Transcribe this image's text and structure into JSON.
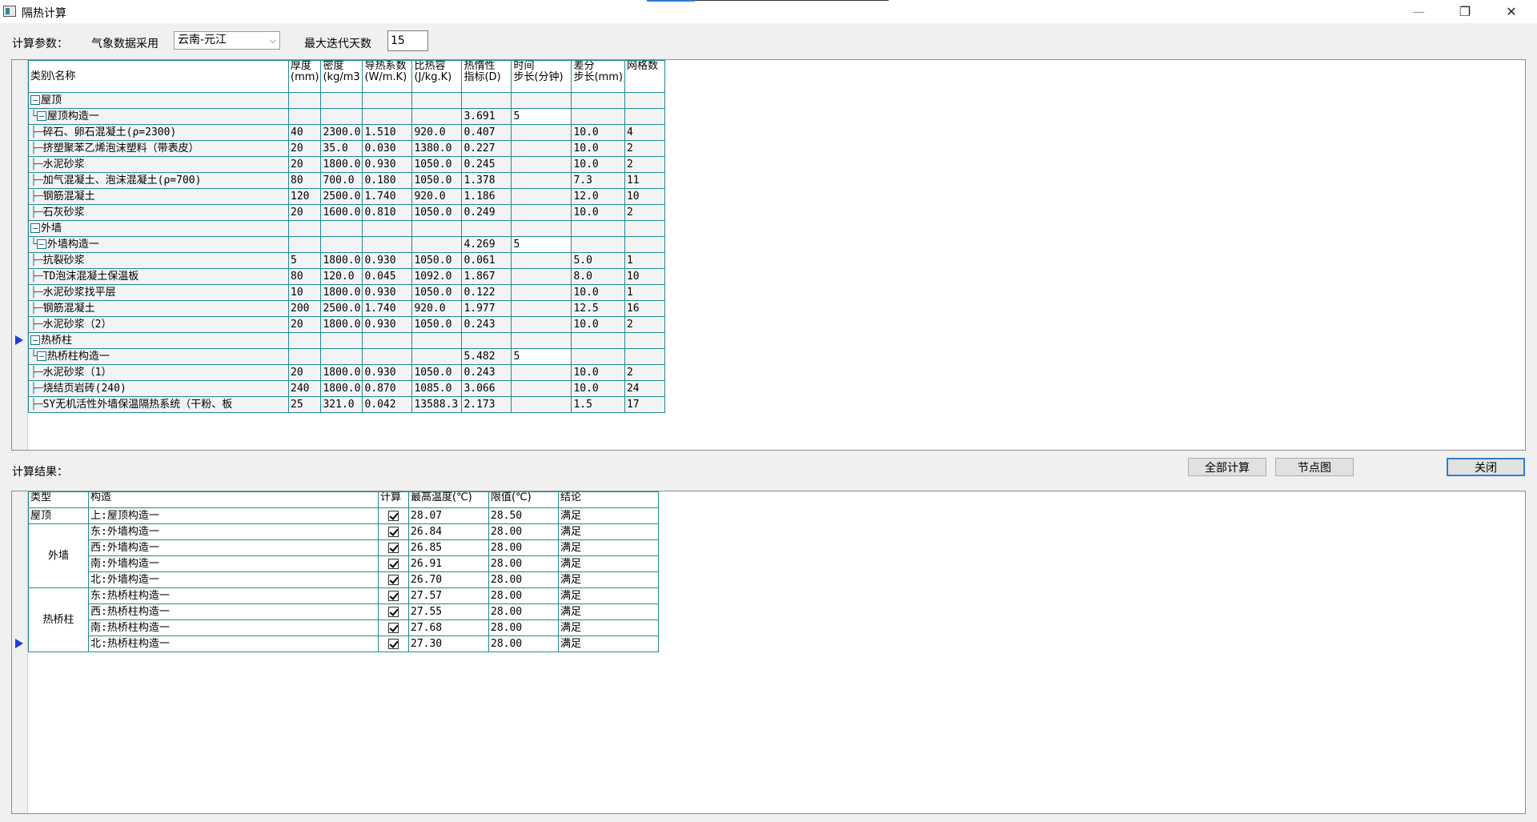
{
  "window": {
    "title": "隔热计算",
    "minimize": "—",
    "restore": "❐",
    "close": "✕"
  },
  "params": {
    "label": "计算参数：",
    "weather_label": "气象数据采用",
    "weather_value": "云南-元江",
    "max_days_label": "最大迭代天数",
    "max_days_value": "15"
  },
  "layers": {
    "headers": [
      "类别\\名称",
      "厚度\n(mm)",
      "密度\n(kg/m3",
      "导热系数\n(W/m.K)",
      "比热容\n(J/kg.K)",
      "热惰性\n指标(D)",
      "时间\n步长(分钟)",
      "差分\n步长(mm)",
      "网格数"
    ],
    "rows": [
      {
        "level": 0,
        "name": "屋顶",
        "cells": [
          "",
          "",
          "",
          "",
          "",
          "",
          "",
          ""
        ]
      },
      {
        "level": 1,
        "name": "屋顶构造一",
        "cells": [
          "",
          "",
          "",
          "",
          "3.691",
          "5",
          "",
          ""
        ]
      },
      {
        "level": 2,
        "name": "碎石、卵石混凝土(ρ=2300)",
        "cells": [
          "40",
          "2300.0",
          "1.510",
          "920.0",
          "0.407",
          "",
          "10.0",
          "4"
        ]
      },
      {
        "level": 2,
        "name": "挤塑聚苯乙烯泡沫塑料（带表皮）",
        "cells": [
          "20",
          "35.0",
          "0.030",
          "1380.0",
          "0.227",
          "",
          "10.0",
          "2"
        ]
      },
      {
        "level": 2,
        "name": "水泥砂浆",
        "cells": [
          "20",
          "1800.0",
          "0.930",
          "1050.0",
          "0.245",
          "",
          "10.0",
          "2"
        ]
      },
      {
        "level": 2,
        "name": "加气混凝土、泡沫混凝土(ρ=700)",
        "cells": [
          "80",
          "700.0",
          "0.180",
          "1050.0",
          "1.378",
          "",
          "7.3",
          "11"
        ]
      },
      {
        "level": 2,
        "name": "钢筋混凝土",
        "cells": [
          "120",
          "2500.0",
          "1.740",
          "920.0",
          "1.186",
          "",
          "12.0",
          "10"
        ]
      },
      {
        "level": 2,
        "name": "石灰砂浆",
        "cells": [
          "20",
          "1600.0",
          "0.810",
          "1050.0",
          "0.249",
          "",
          "10.0",
          "2"
        ]
      },
      {
        "level": 0,
        "name": "外墙",
        "cells": [
          "",
          "",
          "",
          "",
          "",
          "",
          "",
          ""
        ]
      },
      {
        "level": 1,
        "name": "外墙构造一",
        "cells": [
          "",
          "",
          "",
          "",
          "4.269",
          "5",
          "",
          ""
        ]
      },
      {
        "level": 2,
        "name": "抗裂砂浆",
        "cells": [
          "5",
          "1800.0",
          "0.930",
          "1050.0",
          "0.061",
          "",
          "5.0",
          "1"
        ]
      },
      {
        "level": 2,
        "name": "TD泡沫混凝土保温板",
        "cells": [
          "80",
          "120.0",
          "0.045",
          "1092.0",
          "1.867",
          "",
          "8.0",
          "10"
        ]
      },
      {
        "level": 2,
        "name": "水泥砂浆找平层",
        "cells": [
          "10",
          "1800.0",
          "0.930",
          "1050.0",
          "0.122",
          "",
          "10.0",
          "1"
        ]
      },
      {
        "level": 2,
        "name": "钢筋混凝土",
        "cells": [
          "200",
          "2500.0",
          "1.740",
          "920.0",
          "1.977",
          "",
          "12.5",
          "16"
        ]
      },
      {
        "level": 2,
        "name": "水泥砂浆（2）",
        "cells": [
          "20",
          "1800.0",
          "0.930",
          "1050.0",
          "0.243",
          "",
          "10.0",
          "2"
        ]
      },
      {
        "level": 0,
        "name": "热桥柱",
        "cells": [
          "",
          "",
          "",
          "",
          "",
          "",
          "",
          ""
        ]
      },
      {
        "level": 1,
        "name": "热桥柱构造一",
        "cells": [
          "",
          "",
          "",
          "",
          "5.482",
          "5",
          "",
          ""
        ]
      },
      {
        "level": 2,
        "name": "水泥砂浆（1）",
        "cells": [
          "20",
          "1800.0",
          "0.930",
          "1050.0",
          "0.243",
          "",
          "10.0",
          "2"
        ]
      },
      {
        "level": 2,
        "name": "烧结页岩砖(240)",
        "cells": [
          "240",
          "1800.0",
          "0.870",
          "1085.0",
          "3.066",
          "",
          "10.0",
          "24"
        ]
      },
      {
        "level": 2,
        "name": "SY无机活性外墙保温隔热系统（干粉、板",
        "cells": [
          "25",
          "321.0",
          "0.042",
          "13588.3",
          "2.173",
          "",
          "1.5",
          "17"
        ]
      }
    ],
    "current_row": 15
  },
  "results_label": "计算结果：",
  "buttons": {
    "calc_all": "全部计算",
    "node_chart": "节点图",
    "close": "关闭"
  },
  "results": {
    "headers": [
      "类型",
      "构造",
      "计算",
      "最高温度(℃)",
      "限值(℃)",
      "结论"
    ],
    "groups": [
      {
        "type": "屋顶",
        "rows": [
          {
            "construct": "上:屋顶构造一",
            "checked": true,
            "tmax": "28.07",
            "limit": "28.50",
            "result": "满足"
          }
        ]
      },
      {
        "type": "外墙",
        "rows": [
          {
            "construct": "东:外墙构造一",
            "checked": true,
            "tmax": "26.84",
            "limit": "28.00",
            "result": "满足"
          },
          {
            "construct": "西:外墙构造一",
            "checked": true,
            "tmax": "26.85",
            "limit": "28.00",
            "result": "满足"
          },
          {
            "construct": "南:外墙构造一",
            "checked": true,
            "tmax": "26.91",
            "limit": "28.00",
            "result": "满足"
          },
          {
            "construct": "北:外墙构造一",
            "checked": true,
            "tmax": "26.70",
            "limit": "28.00",
            "result": "满足"
          }
        ]
      },
      {
        "type": "热桥柱",
        "rows": [
          {
            "construct": "东:热桥柱构造一",
            "checked": true,
            "tmax": "27.57",
            "limit": "28.00",
            "result": "满足"
          },
          {
            "construct": "西:热桥柱构造一",
            "checked": true,
            "tmax": "27.55",
            "limit": "28.00",
            "result": "满足"
          },
          {
            "construct": "南:热桥柱构造一",
            "checked": true,
            "tmax": "27.68",
            "limit": "28.00",
            "result": "满足"
          },
          {
            "construct": "北:热桥柱构造一",
            "checked": true,
            "tmax": "27.30",
            "limit": "28.00",
            "result": "满足"
          }
        ]
      }
    ],
    "current_row": 8
  }
}
